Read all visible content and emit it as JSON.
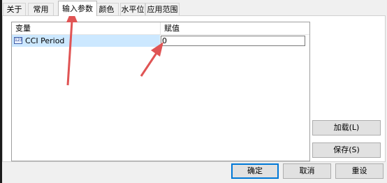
{
  "tabs": [
    {
      "label": "关于"
    },
    {
      "label": "常用"
    },
    {
      "label": "输入参数"
    },
    {
      "label": "颜色"
    },
    {
      "label": "水平位"
    },
    {
      "label": "应用范围"
    }
  ],
  "grid": {
    "columns": [
      "变量",
      "赋值"
    ],
    "rows": [
      {
        "type_icon": "123",
        "name": "CCI Period",
        "value": "0"
      }
    ]
  },
  "side_buttons": {
    "load": "加载(L)",
    "save": "保存(S)"
  },
  "footer_buttons": {
    "ok": "确定",
    "cancel": "取消",
    "reset": "重设"
  },
  "annotation_color": "#e05454"
}
